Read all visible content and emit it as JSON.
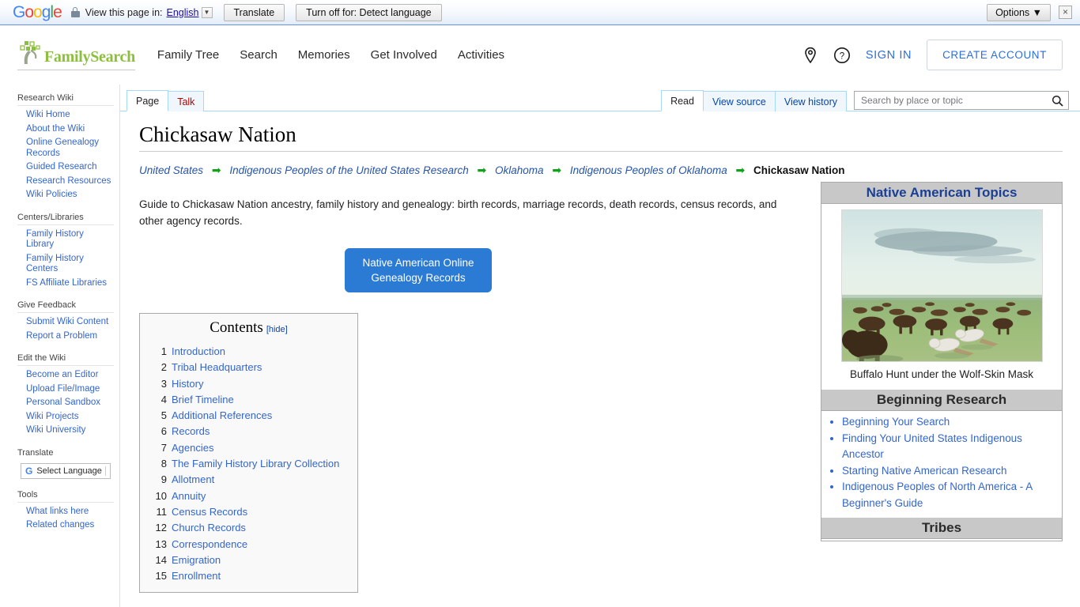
{
  "translate_bar": {
    "logo": "Google",
    "lock_icon": "lock-icon",
    "view_label": "View this page in:",
    "language": "English",
    "dropdown_icon": "chevron-down-icon",
    "translate_button": "Translate",
    "turn_off_button": "Turn off for: Detect language",
    "options_button": "Options ▼",
    "close_icon": "×"
  },
  "header": {
    "logo_text": "FamilySearch",
    "logo_icon": "family-tree-logo-icon",
    "nav": [
      {
        "label": "Family Tree"
      },
      {
        "label": "Search"
      },
      {
        "label": "Memories"
      },
      {
        "label": "Get Involved"
      },
      {
        "label": "Activities"
      }
    ],
    "location_icon": "location-pin-icon",
    "help_icon": "help-circle-icon",
    "sign_in": "SIGN IN",
    "create_account": "CREATE ACCOUNT"
  },
  "sidebar": {
    "sections": [
      {
        "title": "Research Wiki",
        "items": [
          "Wiki Home",
          "About the Wiki",
          "Online Genealogy Records",
          "Guided Research",
          "Research Resources",
          "Wiki Policies"
        ]
      },
      {
        "title": "Centers/Libraries",
        "items": [
          "Family History Library",
          "Family History Centers",
          "FS Affiliate Libraries"
        ]
      },
      {
        "title": "Give Feedback",
        "items": [
          "Submit Wiki Content",
          "Report a Problem"
        ]
      },
      {
        "title": "Edit the Wiki",
        "items": [
          "Become an Editor",
          "Upload File/Image",
          "Personal Sandbox",
          "Wiki Projects",
          "Wiki University"
        ]
      }
    ],
    "translate_title": "Translate",
    "select_language": "Select Language",
    "select_language_icon": "google-g-icon",
    "tools_title": "Tools",
    "tools_items": [
      "What links here",
      "Related changes"
    ]
  },
  "tabs": {
    "left": [
      {
        "label": "Page",
        "state": "active"
      },
      {
        "label": "Talk",
        "state": "redlink"
      }
    ],
    "right": [
      {
        "label": "Read",
        "state": "active"
      },
      {
        "label": "View source",
        "state": "normal"
      },
      {
        "label": "View history",
        "state": "normal"
      }
    ]
  },
  "search": {
    "placeholder": "Search by place or topic",
    "value": "",
    "icon": "search-icon"
  },
  "main": {
    "title": "Chickasaw Nation",
    "breadcrumb": [
      {
        "label": "United States",
        "current": false
      },
      {
        "label": "Indigenous Peoples of the United States Research",
        "current": false
      },
      {
        "label": "Oklahoma",
        "current": false
      },
      {
        "label": "Indigenous Peoples of Oklahoma",
        "current": false
      },
      {
        "label": "Chickasaw Nation",
        "current": true
      }
    ],
    "breadcrumb_arrow": "➡",
    "intro": "Guide to Chickasaw Nation ancestry, family history and genealogy: birth records, marriage records, death records, census records, and other agency records.",
    "cta_line1": "Native American Online",
    "cta_line2": "Genealogy Records"
  },
  "toc": {
    "title": "Contents",
    "hide_label": "[hide]",
    "items": [
      {
        "num": "1",
        "label": "Introduction"
      },
      {
        "num": "2",
        "label": "Tribal Headquarters"
      },
      {
        "num": "3",
        "label": "History"
      },
      {
        "num": "4",
        "label": "Brief Timeline"
      },
      {
        "num": "5",
        "label": "Additional References"
      },
      {
        "num": "6",
        "label": "Records"
      },
      {
        "num": "7",
        "label": "Agencies"
      },
      {
        "num": "8",
        "label": "The Family History Library Collection"
      },
      {
        "num": "9",
        "label": "Allotment"
      },
      {
        "num": "10",
        "label": "Annuity"
      },
      {
        "num": "11",
        "label": "Census Records"
      },
      {
        "num": "12",
        "label": "Church Records"
      },
      {
        "num": "13",
        "label": "Correspondence"
      },
      {
        "num": "14",
        "label": "Emigration"
      },
      {
        "num": "15",
        "label": "Enrollment"
      }
    ]
  },
  "infobox": {
    "title": "Native American Topics",
    "image_name": "buffalo-hunt-painting",
    "image_caption": "Buffalo Hunt under the Wolf-Skin Mask",
    "sections": [
      {
        "heading": "Beginning Research",
        "items": [
          "Beginning Your Search",
          "Finding Your United States Indigenous Ancestor",
          "Starting Native American Research",
          "Indigenous Peoples of North America - A Beginner's Guide"
        ]
      },
      {
        "heading": "Tribes",
        "items": []
      }
    ]
  },
  "colors": {
    "link_blue": "#36c",
    "brand_green": "#8dbf3f",
    "cta_blue": "#2b7bd4",
    "infobox_head_grey": "#c8c8c8",
    "infobox_title_navy": "#1b3f94",
    "tab_border_blue": "#a7d7f9",
    "arrow_green": "#13a01a"
  }
}
